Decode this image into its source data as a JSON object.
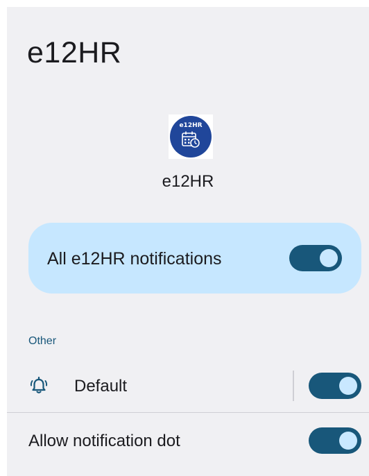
{
  "page": {
    "title": "e12HR"
  },
  "app": {
    "icon_name": "e12hr-calendar-app-icon",
    "icon_text": "e12HR",
    "name": "e12HR"
  },
  "master_toggle": {
    "label": "All e12HR notifications",
    "on": true
  },
  "section": {
    "header": "Other"
  },
  "channels": [
    {
      "icon": "bell-ringing-icon",
      "label": "Default",
      "on": true
    }
  ],
  "notification_dot": {
    "label": "Allow notification dot",
    "on": true
  },
  "colors": {
    "background": "#f0f0f3",
    "card": "#c6e7ff",
    "accent": "#18577a",
    "switch_knob": "#c9e8ff",
    "icon_blue": "#20469a"
  }
}
